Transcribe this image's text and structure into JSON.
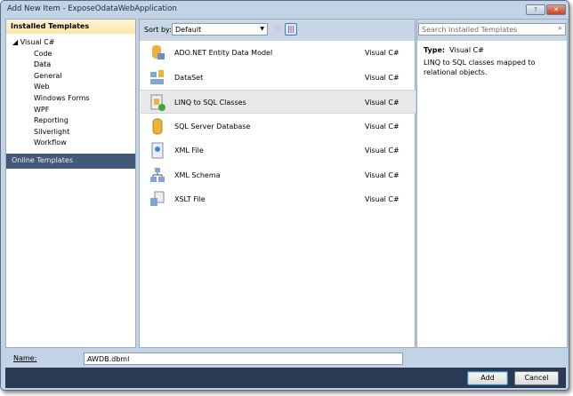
{
  "window": {
    "title": "Add New Item - ExposeOdataWebApplication",
    "help": "?",
    "close": "✕"
  },
  "left": {
    "header": "Installed Templates",
    "root": "Visual C#",
    "items": [
      "Code",
      "Data",
      "General",
      "Web",
      "Windows Forms",
      "WPF",
      "Reporting",
      "Silverlight",
      "Workflow"
    ],
    "online": "Online Templates"
  },
  "toolbar": {
    "sort_label": "Sort by:",
    "sort_value": "Default"
  },
  "search": {
    "placeholder": "Search Installed Templates"
  },
  "templates": [
    {
      "name": "ADO.NET Entity Data Model",
      "type": "Visual C#"
    },
    {
      "name": "DataSet",
      "type": "Visual C#"
    },
    {
      "name": "LINQ to SQL Classes",
      "type": "Visual C#"
    },
    {
      "name": "SQL Server Database",
      "type": "Visual C#"
    },
    {
      "name": "XML File",
      "type": "Visual C#"
    },
    {
      "name": "XML Schema",
      "type": "Visual C#"
    },
    {
      "name": "XSLT File",
      "type": "Visual C#"
    }
  ],
  "details": {
    "type_label": "Type:",
    "type_value": "Visual C#",
    "description": "LINQ to SQL classes mapped to relational objects."
  },
  "name": {
    "label": "Name:",
    "value": "AWDB.dbml"
  },
  "buttons": {
    "add": "Add",
    "cancel": "Cancel"
  }
}
